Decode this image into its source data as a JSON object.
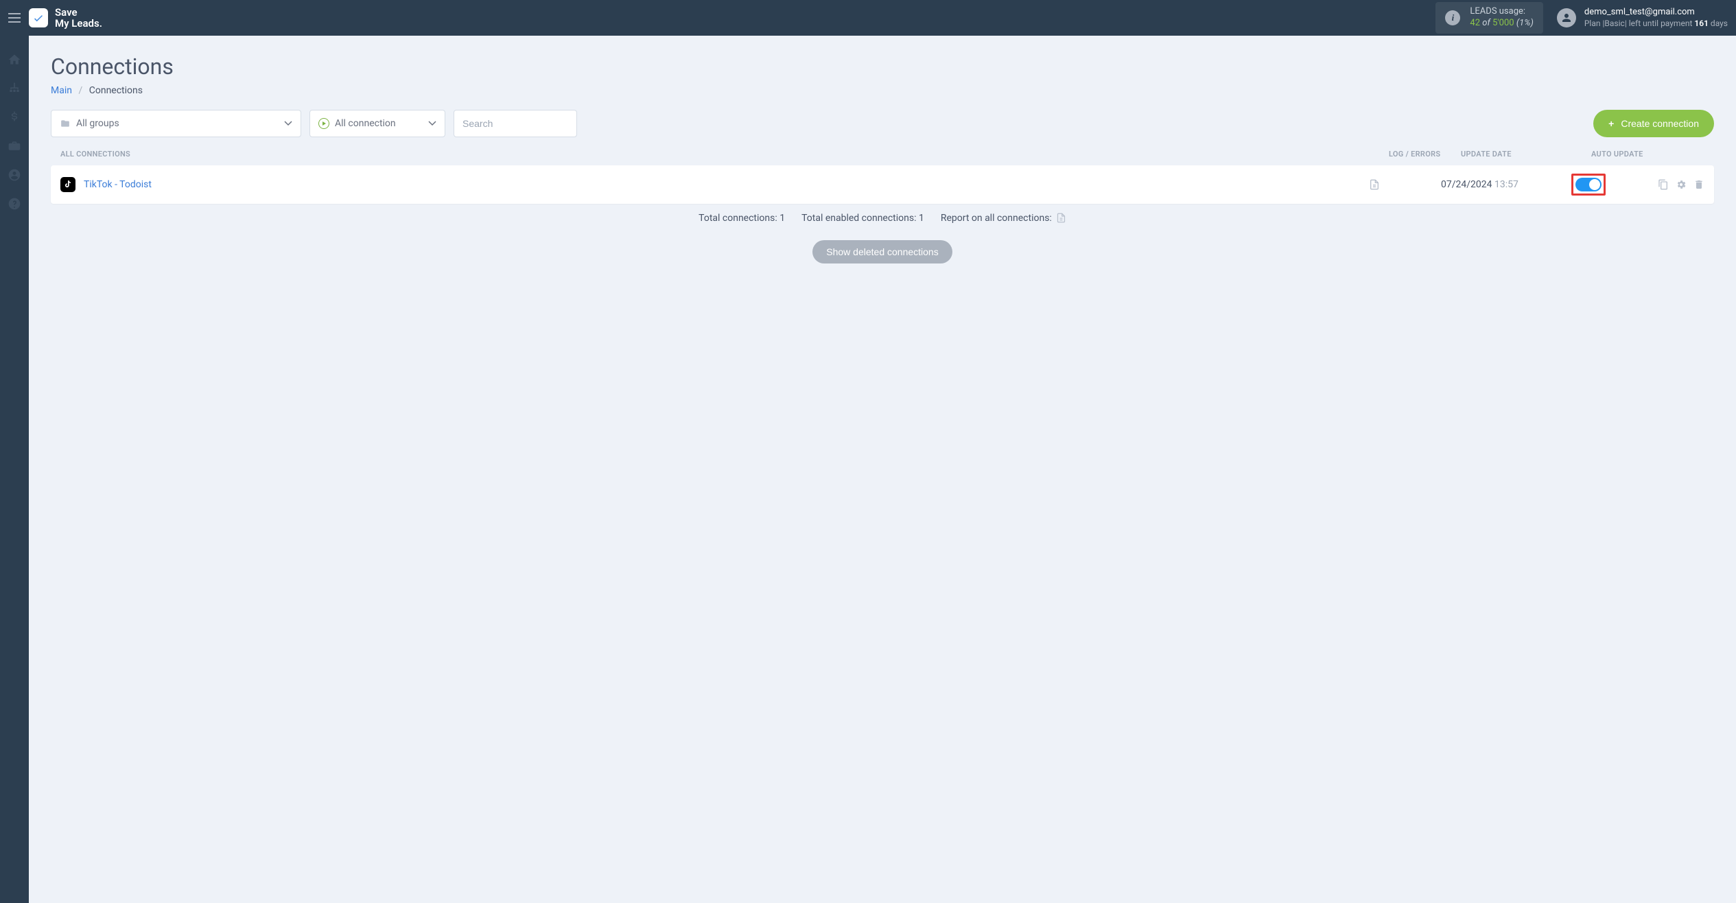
{
  "header": {
    "logo_line1": "Save",
    "logo_line2": "My Leads.",
    "leads_label": "LEADS usage:",
    "leads_used": "42",
    "leads_of": "of",
    "leads_total": "5'000",
    "leads_pct": "(1%)",
    "user_email": "demo_sml_test@gmail.com",
    "plan_prefix": "Plan |",
    "plan_name": "Basic",
    "plan_middle": "| left until payment",
    "plan_days": "161",
    "plan_suffix": "days"
  },
  "page": {
    "title": "Connections",
    "breadcrumb_main": "Main",
    "breadcrumb_current": "Connections"
  },
  "filters": {
    "groups_label": "All groups",
    "status_label": "All connection",
    "search_placeholder": "Search",
    "create_label": "Create connection"
  },
  "table": {
    "head_all": "ALL CONNECTIONS",
    "head_log": "LOG / ERRORS",
    "head_date": "UPDATE DATE",
    "head_auto": "AUTO UPDATE",
    "rows": [
      {
        "icon_letter": "♪",
        "title": "TikTok - Todoist",
        "date": "07/24/2024",
        "time": "13:57",
        "auto_on": true
      }
    ]
  },
  "summary": {
    "total_conn": "Total connections: 1",
    "total_enabled": "Total enabled connections: 1",
    "report_label": "Report on all connections:",
    "show_deleted": "Show deleted connections"
  }
}
